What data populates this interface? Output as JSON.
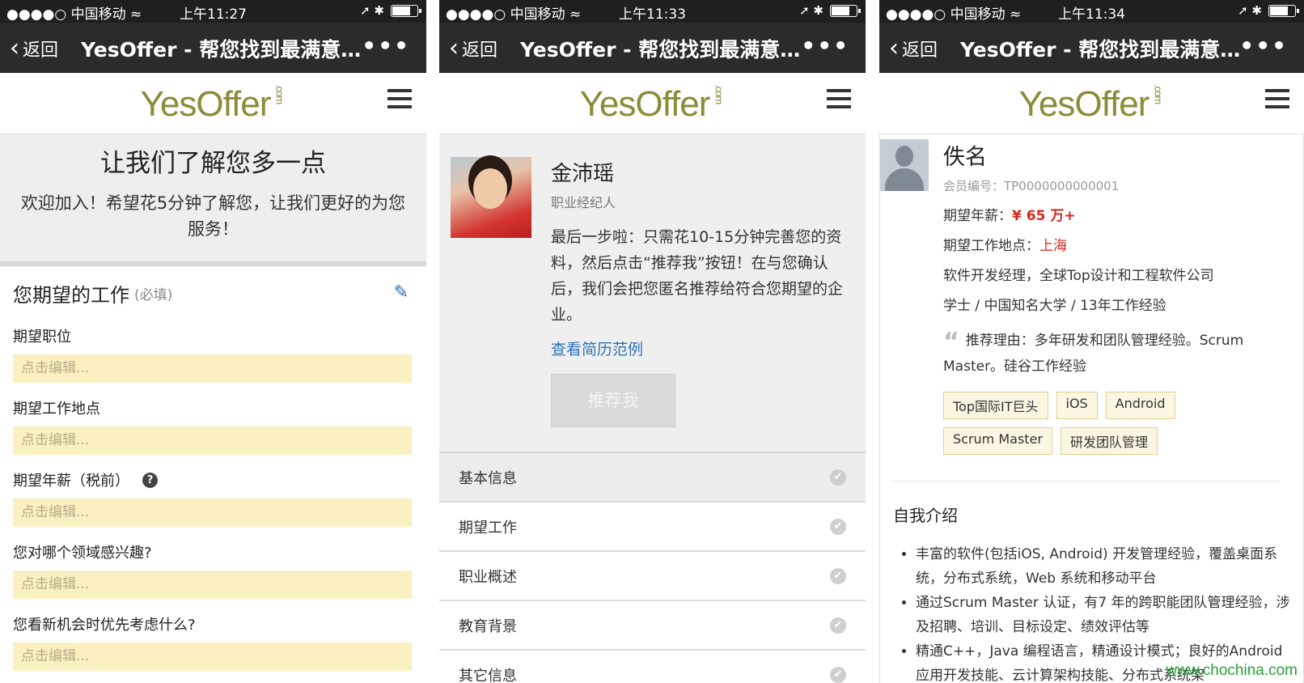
{
  "screens": [
    {
      "status": {
        "carrier": "●●●●○ 中国移动 ≈",
        "time": "上午11:27",
        "icons": "➚ ✱"
      },
      "nav": {
        "back": "返回",
        "title": "YesOffer - 帮您找到最满意的...",
        "more": "•••"
      },
      "logo": {
        "text": "YesOffer",
        "suffix": ".com"
      }
    },
    {
      "status": {
        "carrier": "●●●●○ 中国移动 ≈",
        "time": "上午11:33",
        "icons": "➚ ✱"
      },
      "nav": {
        "back": "返回",
        "title": "YesOffer - 帮您找到最满意的...",
        "more": "•••"
      },
      "logo": {
        "text": "YesOffer",
        "suffix": ".com"
      }
    },
    {
      "status": {
        "carrier": "●●●●○ 中国移动 ≈",
        "time": "上午11:34",
        "icons": "➚ ✱"
      },
      "nav": {
        "back": "返回",
        "title": "YesOffer - 帮您找到最满意的...",
        "more": "•••"
      },
      "logo": {
        "text": "YesOffer",
        "suffix": ".com"
      }
    }
  ],
  "form": {
    "heading": "让我们了解您多一点",
    "welcome": "欢迎加入！希望花5分钟了解您，让我们更好的为您服务！",
    "section_title": "您期望的工作",
    "section_required": "(必填)",
    "placeholder": "点击编辑...",
    "fields": [
      {
        "label": "期望职位"
      },
      {
        "label": "期望工作地点"
      },
      {
        "label": "期望年薪（税前）"
      },
      {
        "label": "您对哪个领域感兴趣?"
      },
      {
        "label": "您看新机会时优先考虑什么?"
      }
    ]
  },
  "agent": {
    "name": "金沛瑶",
    "role": "职业经纪人",
    "message": "最后一步啦：只需花10-15分钟完善您的资料，然后点击“推荐我”按钮！在与您确认后，我们会把您匿名推荐给符合您期望的企业。",
    "example_link": "查看简历范例",
    "recommend_button": "推荐我",
    "menu": [
      "基本信息",
      "期望工作",
      "职业概述",
      "教育背景",
      "其它信息"
    ]
  },
  "candidate": {
    "name": "佚名",
    "member_no": "会员编号：TP0000000000001",
    "salary_label": "期望年薪：",
    "salary_value": "¥ 65 万+",
    "location_label": "期望工作地点：",
    "location_value": "上海",
    "position": "软件开发经理，全球Top设计和工程软件公司",
    "education": "学士 / 中国知名大学 / 13年工作经验",
    "reason": "推荐理由：多年研发和团队管理经验。Scrum Master。硅谷工作经验",
    "tags": [
      "Top国际IT巨头",
      "iOS",
      "Android",
      "Scrum Master",
      "研发团队管理"
    ],
    "intro_title": "自我介绍",
    "intro_items": [
      "丰富的软件(包括iOS, Android) 开发管理经验，覆盖桌面系统，分布式系统，Web 系统和移动平台",
      "通过Scrum Master 认证，有7 年的跨职能团队管理经验，涉及招聘、培训、目标设定、绩效评估等",
      "精通C++，Java 编程语言，精通设计模式；良好的Android 应用开发技能、云计算架构技能、分布式系统架"
    ]
  },
  "watermark": "www.chochina.com",
  "colors": {
    "logo": "#8b8b38",
    "field_bg": "#faf0c2",
    "link": "#2d73b6",
    "accent_red": "#d9261c",
    "nav_bg": "#2b2b2b"
  }
}
